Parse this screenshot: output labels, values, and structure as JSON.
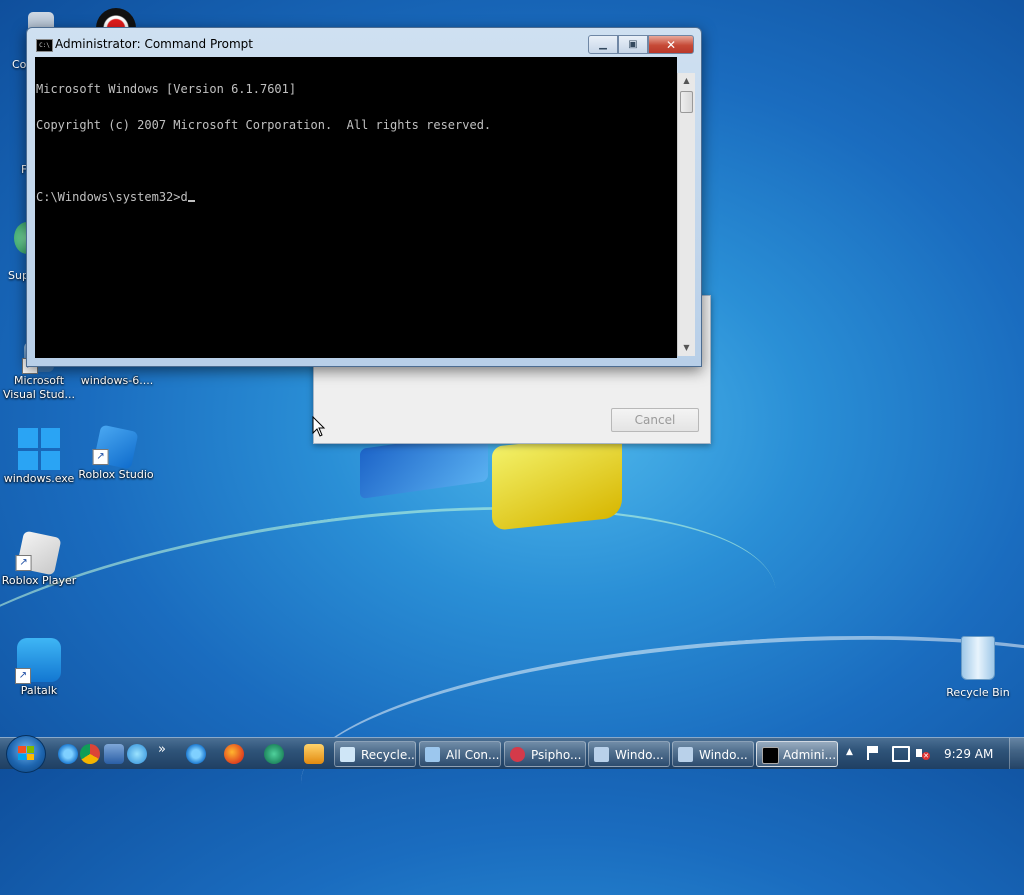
{
  "command_prompt": {
    "title": "Administrator: Command Prompt",
    "lines": [
      "Microsoft Windows [Version 6.1.7601]",
      "Copyright (c) 2007 Microsoft Corporation.  All rights reserved.",
      "",
      "C:\\Windows\\system32>d"
    ],
    "buttons": {
      "minimize": "minimize",
      "maximize": "maximize",
      "close": "close"
    }
  },
  "background_dialog": {
    "cancel_label": "Cancel"
  },
  "desktop_icons": [
    {
      "label_1": "Microsoft",
      "label_2": "Visual Stud...",
      "icon": "visual-studio-icon"
    },
    {
      "label_1": "windows-6....",
      "icon": "file-icon"
    },
    {
      "label_1": "windows.exe",
      "icon": "windows-logo-icon"
    },
    {
      "label_1": "Roblox Studio",
      "icon": "roblox-studio-icon"
    },
    {
      "label_1": "Roblox Player",
      "icon": "roblox-player-icon"
    },
    {
      "label_1": "Paltalk",
      "icon": "paltalk-icon"
    },
    {
      "label_1": "Recycle Bin",
      "icon": "recycle-bin-icon"
    }
  ],
  "edge_icon_fragments": [
    "Co",
    "F",
    "Sup"
  ],
  "taskbar": {
    "quick_launch": [
      "ie-icon",
      "chrome-icon",
      "virtualbox-icon",
      "messenger-icon"
    ],
    "overflow": "»",
    "pinned": [
      "ie-icon",
      "firefox-icon",
      "app-icon",
      "media-player-icon"
    ],
    "buttons": [
      {
        "label": "Recycle...",
        "icon": "recycle-bin-icon"
      },
      {
        "label": "All Con...",
        "icon": "control-panel-icon"
      },
      {
        "label": "Psipho...",
        "icon": "psiphon-icon"
      },
      {
        "label": "Windo...",
        "icon": "installer-icon"
      },
      {
        "label": "Windo...",
        "icon": "installer-icon"
      },
      {
        "label": "Admini...",
        "icon": "cmd-icon",
        "active": true
      }
    ],
    "tray_arrow": "▲",
    "clock": "9:29 AM"
  },
  "colors": {
    "console_bg": "#000000",
    "console_text": "#c0c0c0",
    "taskbar": "#2f5479",
    "close_button": "#c64a37"
  }
}
